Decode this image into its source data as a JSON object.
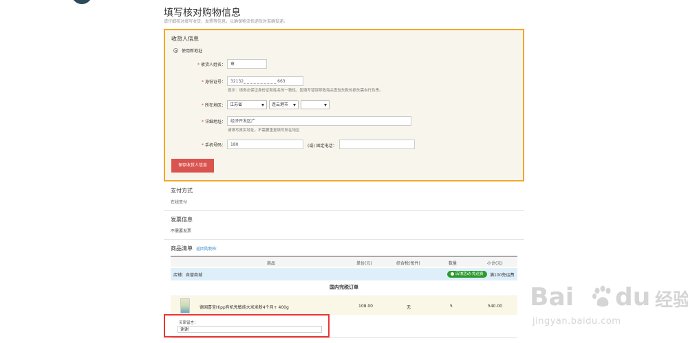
{
  "header": {
    "title": "填写核对购物信息",
    "subtitle": "请仔细核对填写收货、发票等信息，以确保物流快递及时准确投递。"
  },
  "address": {
    "section_title": "收货人信息",
    "use_new_address": "使用新地址",
    "name_label": "收货人姓名：",
    "name_value": "章",
    "id_label": "身份证号：",
    "id_value": "32132_ _ _ _ _ _ _ _ _ _ 663",
    "id_hint": "提示：请务必保证身份证和姓名的一致性，因填写错误导致海关查验失败的损失需自行负责。",
    "region_label": "所在地区：",
    "province": "江苏省",
    "city": "连云港市",
    "district": "",
    "detail_label": "详细地址：",
    "detail_value": "经济开发区广",
    "detail_hint": "请填写真实地址，不需要重复填写所在地区",
    "mobile_label": "手机号码：",
    "mobile_value": "180",
    "or_phone_label": "(或) 固定电话：",
    "phone_value": "",
    "save_button": "保存收货人信息"
  },
  "payment": {
    "title": "支付方式",
    "value": "在线支付"
  },
  "invoice": {
    "title": "发票信息",
    "value": "不需要发票"
  },
  "goods": {
    "title": "商品清单",
    "back_link": "返回购物车",
    "columns": [
      "商品",
      "单价(元)",
      "综合税(每件)",
      "数量",
      "小计(元)"
    ],
    "store_name": "店铺：自营商城",
    "store_badge": "店铺活动-免运费",
    "store_shipping": "满100免运费",
    "order_type": "国内完税订单",
    "product": {
      "name": "德国喜宝Hipp有机免敏纯大米米粉4个月+ 400g",
      "price": "108.00",
      "tax": "无",
      "qty": "5",
      "subtotal": "540.00"
    },
    "note_label": "买家留言：",
    "note_value": "谢谢"
  },
  "watermark": {
    "brand_left": "Bai",
    "brand_right": "du",
    "brand_cn": "经验",
    "url": "jingyan.baidu.com"
  },
  "colors": {
    "highlight_border": "#f5a623",
    "save_button": "#d9534f",
    "note_highlight": "#ee3333",
    "store_bar": "#dfeffa",
    "badge": "#2e9a2e",
    "link": "#3a8fd1"
  }
}
